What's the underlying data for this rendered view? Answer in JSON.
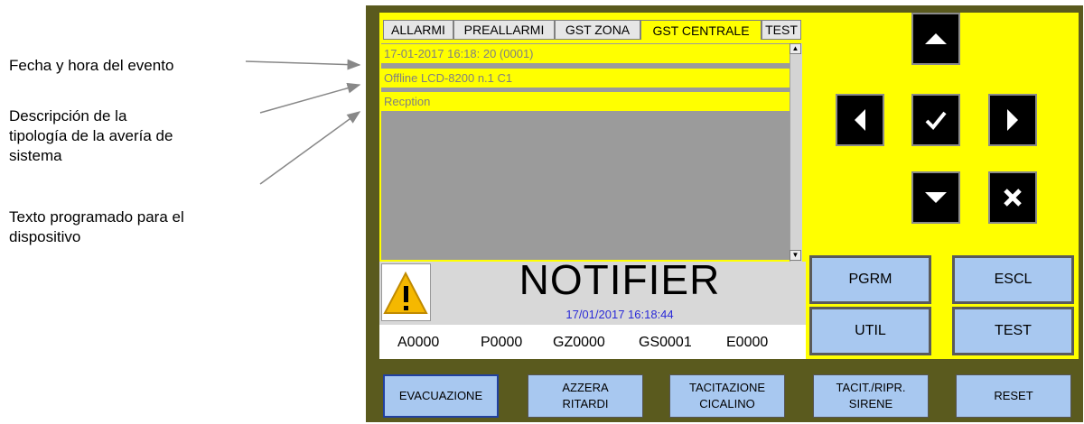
{
  "annotations": {
    "date_time": "Fecha y hora del evento",
    "fault_type": [
      "Descripción de la",
      "tipología de la avería de",
      "sistema"
    ],
    "programmed_text": [
      "Texto programado para el",
      "dispositivo"
    ]
  },
  "tabs": [
    "ALLARMI",
    "PREALLARMI",
    "GST ZONA",
    "GST CENTRALE",
    "TEST"
  ],
  "active_tab": "GST CENTRALE",
  "event": {
    "line1": "17-01-2017 16:18: 20 (0001)",
    "line2": "Offline LCD-8200 n.1 C1",
    "line3": "Recption"
  },
  "brand": "NOTIFIER",
  "datetime": "17/01/2017 16:18:44",
  "counters": [
    "A0000",
    "P0000",
    "GZ0000",
    "GS0001",
    "E0000"
  ],
  "function_buttons": [
    "PGRM",
    "ESCL",
    "UTIL",
    "TEST"
  ],
  "bottom_buttons": [
    {
      "line1": "EVACUAZIONE",
      "line2": ""
    },
    {
      "line1": "AZZERA",
      "line2": "RITARDI"
    },
    {
      "line1": "TACITAZIONE",
      "line2": "CICALINO"
    },
    {
      "line1": "TACIT./RIPR.",
      "line2": "SIRENE"
    },
    {
      "line1": "RESET",
      "line2": ""
    }
  ],
  "colors": {
    "screen": "#ffff00",
    "panel": "#5a5a1e",
    "button": "#a8c8f0",
    "datetime": "#2a2ad8"
  }
}
